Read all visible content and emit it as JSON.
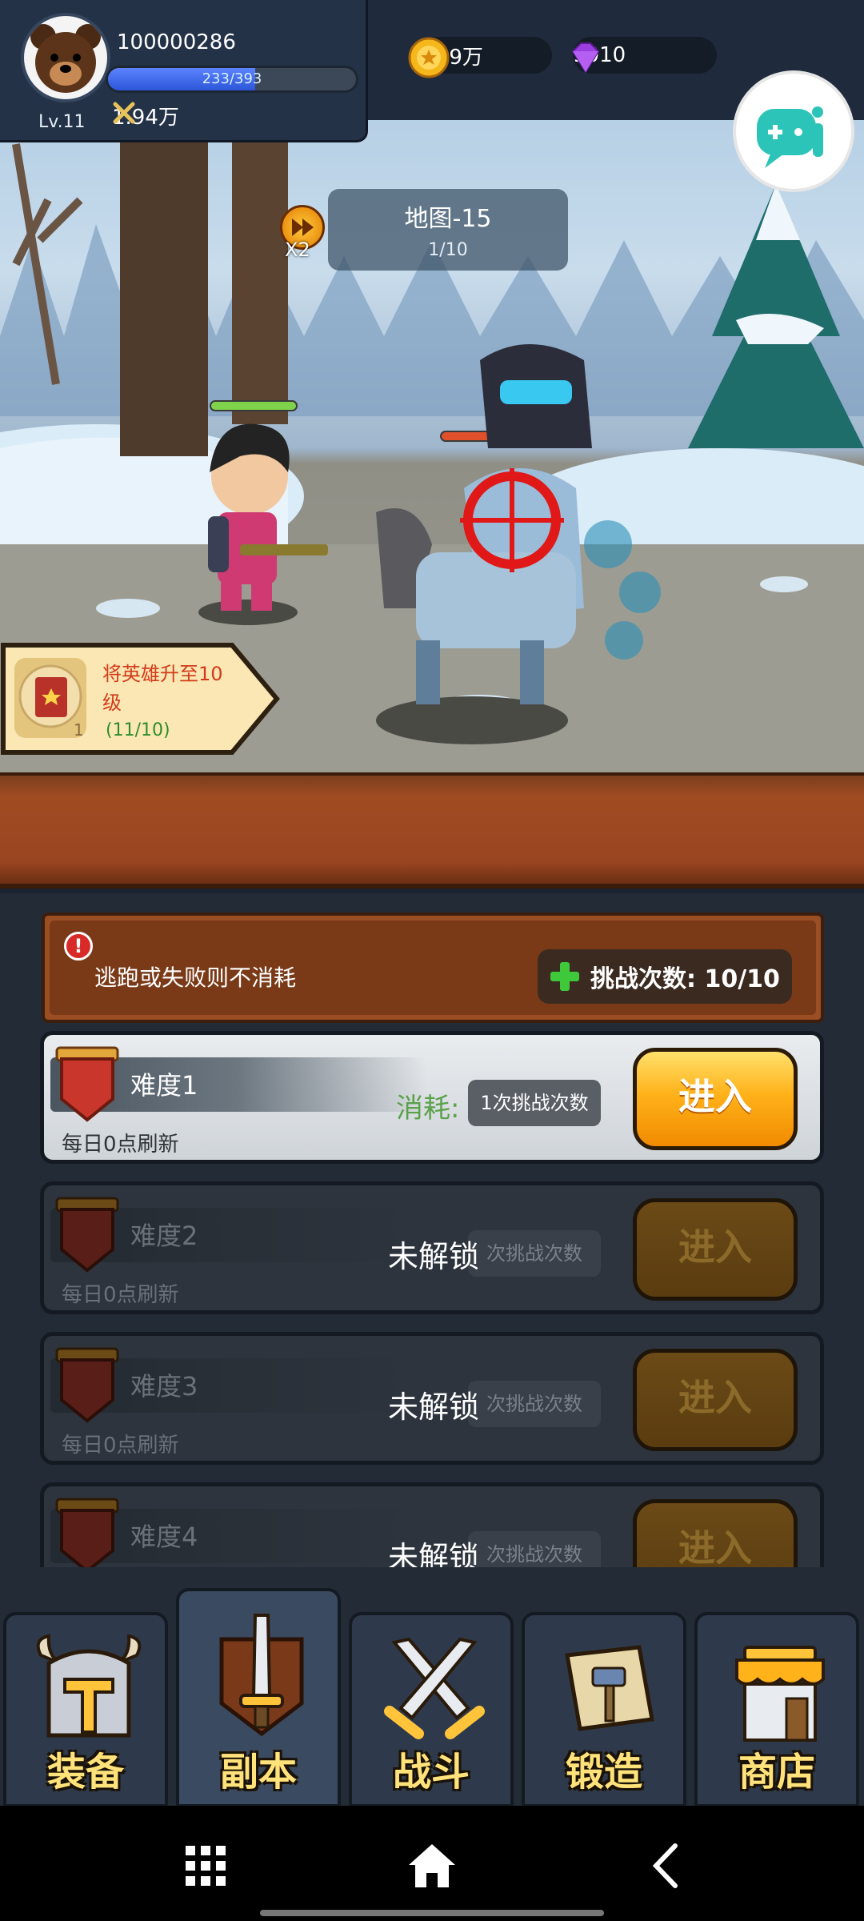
{
  "header": {
    "user_id": "100000286",
    "level": "Lv.11",
    "xp": "233/393",
    "xp_fraction": 0.593,
    "power": "1.94万",
    "gold": "4.19万",
    "gems": "9010"
  },
  "battle": {
    "map_title": "地图-15",
    "wave_progress": "1/10",
    "speed_label": "X2"
  },
  "quest": {
    "text": "将英雄升至10级",
    "progress": "(11/10)",
    "count": "1"
  },
  "dungeon": {
    "notice": "逃跑或失败则不消耗",
    "challenge_count": "挑战次数: 10/10",
    "rows": [
      {
        "name": "难度1",
        "refresh": "每日0点刷新",
        "cost_label": "消耗:",
        "cost": "1次挑战次数",
        "enter": "进入",
        "locked_text": ""
      },
      {
        "name": "难度2",
        "refresh": "每日0点刷新",
        "cost_label": "",
        "cost": "次挑战次数",
        "enter": "进入",
        "locked_text": "未解锁"
      },
      {
        "name": "难度3",
        "refresh": "每日0点刷新",
        "cost_label": "",
        "cost": "次挑战次数",
        "enter": "进入",
        "locked_text": "未解锁"
      },
      {
        "name": "难度4",
        "refresh": "",
        "cost_label": "",
        "cost": "次挑战次数",
        "enter": "进入",
        "locked_text": "未解锁"
      }
    ]
  },
  "tabs": [
    {
      "label": "装备",
      "icon": "helmet-icon"
    },
    {
      "label": "副本",
      "icon": "sword-shield-icon",
      "selected": true
    },
    {
      "label": "战斗",
      "icon": "crossed-swords-icon"
    },
    {
      "label": "锻造",
      "icon": "scroll-hammer-icon"
    },
    {
      "label": "商店",
      "icon": "shop-icon"
    }
  ],
  "colors": {
    "accent_gold": "#ffb21a",
    "wood": "#9a4521",
    "xp_blue": "#2c55d8",
    "quest_red": "#d33a1a",
    "progress_green": "#2d8d2b"
  }
}
